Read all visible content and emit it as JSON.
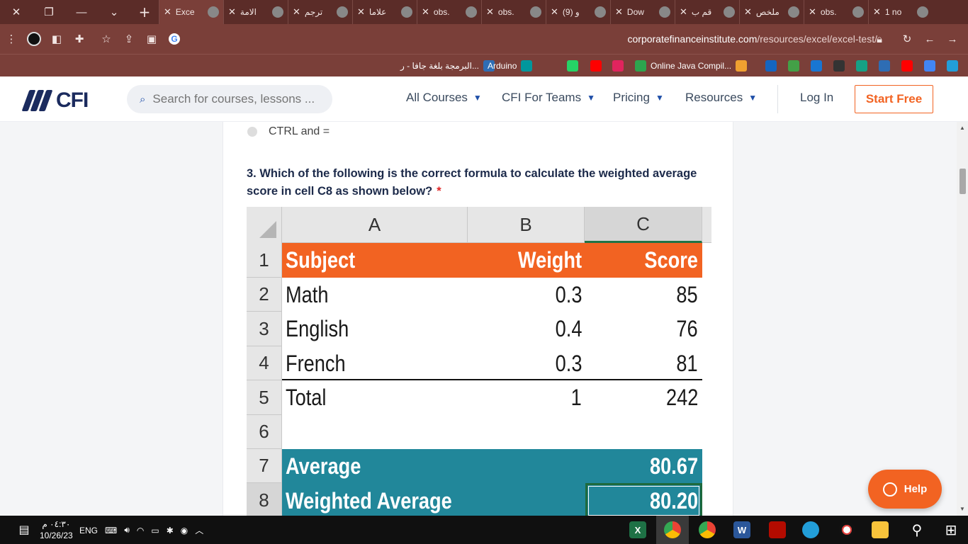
{
  "browser": {
    "tabs": [
      {
        "title": "Exce",
        "active": true,
        "icon": "cfi-icon"
      },
      {
        "title": "الامة",
        "active": false,
        "icon": "form-icon"
      },
      {
        "title": "ترجم",
        "active": false,
        "icon": "translate-icon"
      },
      {
        "title": "علاما",
        "active": false,
        "icon": "chrome-icon"
      },
      {
        "title": "obs.",
        "active": false,
        "icon": "globe-icon"
      },
      {
        "title": "obs.",
        "active": false,
        "icon": "globe-icon"
      },
      {
        "title": "(9) و",
        "active": false,
        "icon": "whatsapp-icon"
      },
      {
        "title": "Dow",
        "active": false,
        "icon": "download-icon"
      },
      {
        "title": "قم ب",
        "active": false,
        "icon": "diamond-icon"
      },
      {
        "title": "ملخص",
        "active": false,
        "icon": "globe-icon"
      },
      {
        "title": "obs.",
        "active": false,
        "icon": "globe-icon"
      },
      {
        "title": "1 no",
        "active": false,
        "icon": "notification-icon"
      }
    ],
    "url_host": "corporatefinanceinstitute.com",
    "url_path": "/resources/excel/excel-test/",
    "bookmarks": [
      {
        "label": "البرمجة بلغة جافا - ر...",
        "color": "#2e6db4"
      },
      {
        "label": "Arduino",
        "color": "#00979c"
      },
      {
        "label": "",
        "color": "#25d366"
      },
      {
        "label": "",
        "color": "#ff0000"
      },
      {
        "label": "",
        "color": "#e0245e"
      },
      {
        "label": "",
        "color": "#2da44e"
      },
      {
        "label": "Online Java Compil...",
        "color": "#f0a030"
      },
      {
        "label": "",
        "color": "#1565c0"
      },
      {
        "label": "",
        "color": "#43a047"
      },
      {
        "label": "",
        "color": "#1976d2"
      },
      {
        "label": "",
        "color": "#333333"
      },
      {
        "label": "",
        "color": "#16a085"
      },
      {
        "label": "",
        "color": "#2e6db4"
      },
      {
        "label": "",
        "color": "#ff0000"
      },
      {
        "label": "",
        "color": "#4285f4"
      },
      {
        "label": "",
        "color": "#229ed9"
      }
    ]
  },
  "header": {
    "logo_text": "CFI",
    "search_placeholder": "Search for courses, lessons ...",
    "nav": [
      "All Courses",
      "CFI For Teams",
      "Pricing",
      "Resources"
    ],
    "login": "Log In",
    "start_free": "Start Free"
  },
  "quiz": {
    "prev_option": "CTRL and =",
    "question": "3. Which of the following is the correct formula to calculate the weighted average score in cell C8 as shown below?",
    "required_mark": "*"
  },
  "spreadsheet": {
    "columns": [
      "A",
      "B",
      "C"
    ],
    "rows": [
      {
        "num": "1",
        "a": "Subject",
        "b": "Weight",
        "c": "Score"
      },
      {
        "num": "2",
        "a": "Math",
        "b": "0.3",
        "c": "85"
      },
      {
        "num": "3",
        "a": "English",
        "b": "0.4",
        "c": "76"
      },
      {
        "num": "4",
        "a": "French",
        "b": "0.3",
        "c": "81"
      },
      {
        "num": "5",
        "a": "Total",
        "b": "1",
        "c": "242"
      },
      {
        "num": "6",
        "a": "",
        "b": "",
        "c": ""
      },
      {
        "num": "7",
        "a": "Average",
        "b": "",
        "c": "80.67"
      },
      {
        "num": "8",
        "a": "Weighted Average",
        "b": "",
        "c": "80.20"
      }
    ],
    "colors": {
      "header_fill": "#f26322",
      "summary_fill": "#21879a",
      "selection": "#1e6a3d"
    }
  },
  "help_button": "Help",
  "taskbar": {
    "time": "٠٤:٣٠ م",
    "date": "10/26/23",
    "lang": "ENG"
  },
  "colors": {
    "accent": "#f26322",
    "brand": "#1b2b5e",
    "browser_frame": "#7a3f39"
  }
}
